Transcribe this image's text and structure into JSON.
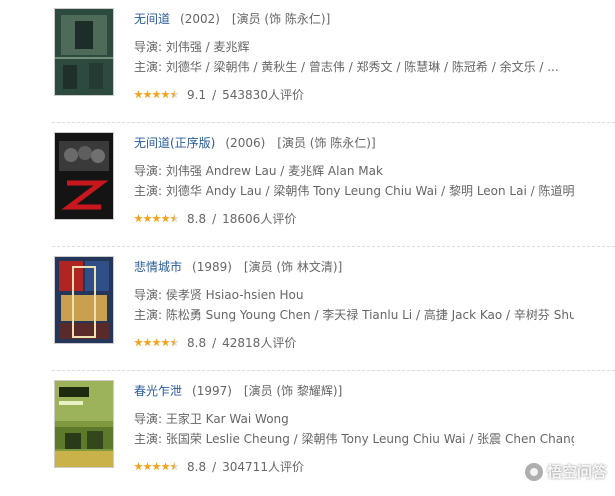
{
  "movies": [
    {
      "title": "无间道",
      "year": "(2002)",
      "role": "[演员 (饰 陈永仁)]",
      "director": "导演: 刘伟强 / 麦兆辉",
      "cast": "主演: 刘德华 / 梁朝伟 / 黄秋生 / 曾志伟 / 郑秀文 / 陈慧琳 / 陈冠希 / 余文乐 / ...",
      "stars": 4.5,
      "score": "9.1",
      "reviews": "543830人评价"
    },
    {
      "title": "无间道(正序版)",
      "year": "(2006)",
      "role": "[演员 (饰 陈永仁)]",
      "director": "导演: 刘伟强 Andrew Lau / 麦兆辉 Alan Mak",
      "cast": "主演: 刘德华 Andy Lau / 梁朝伟 Tony Leung Chiu Wai / 黎明 Leon Lai / 陈道明 Da...",
      "stars": 4.5,
      "score": "8.8",
      "reviews": "18606人评价"
    },
    {
      "title": "悲情城市",
      "year": "(1989)",
      "role": "[演员 (饰 林文清)]",
      "director": "导演: 侯孝贤 Hsiao-hsien Hou",
      "cast": "主演: 陈松勇 Sung Young Chen / 李天禄 Tianlu Li / 高捷 Jack Kao / 辛树芬 Shufa...",
      "stars": 4.5,
      "score": "8.8",
      "reviews": "42818人评价"
    },
    {
      "title": "春光乍泄",
      "year": "(1997)",
      "role": "[演员 (饰 黎耀辉)]",
      "director": "导演: 王家卫 Kar Wai Wong",
      "cast": "主演: 张国荣 Leslie Cheung / 梁朝伟 Tony Leung Chiu Wai / 张震 Chen Chang",
      "stars": 4.5,
      "score": "8.8",
      "reviews": "304711人评价"
    }
  ],
  "colors": {
    "link": "#2a5c9a",
    "meta_text": "#666666",
    "star": "#f3a21a",
    "star_empty": "#d9d9d9",
    "divider": "#dddddd"
  },
  "watermark": {
    "text": "悟空问答",
    "icon": "wukong-logo-icon"
  }
}
